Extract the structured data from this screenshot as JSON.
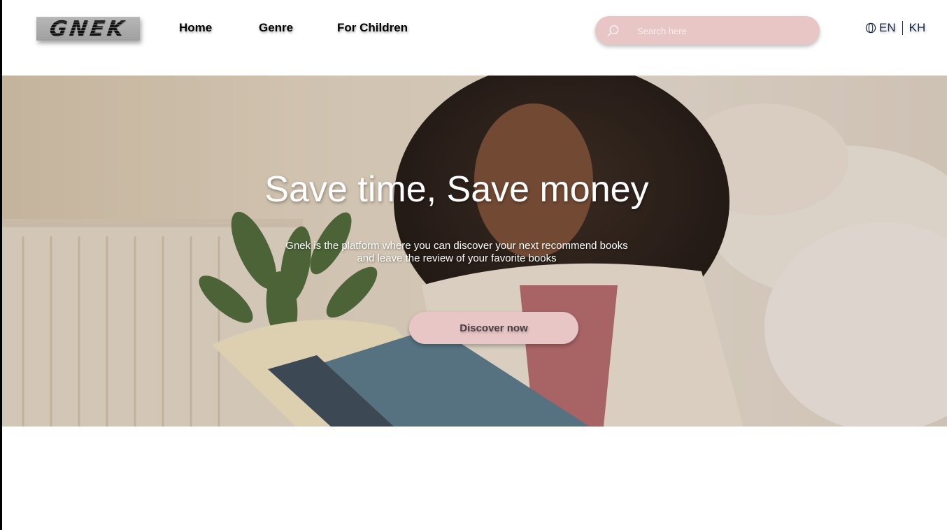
{
  "header": {
    "logo_text": "GNEK",
    "nav": {
      "home": "Home",
      "genre": "Genre",
      "for_children": "For Children"
    },
    "search": {
      "placeholder": "Search here",
      "icon": "search-icon"
    },
    "language": {
      "icon": "globe-icon",
      "options": [
        "EN",
        "KH"
      ]
    }
  },
  "hero": {
    "title": "Save time, Save money",
    "subtitle_line1": "Gnek is the platform where you can discover your next recommend books",
    "subtitle_line2": "and leave the review of your favorite books",
    "cta_label": "Discover now",
    "background_image": "woman reading a book on a sofa"
  },
  "colors": {
    "accent_pink": "#e8c6c6",
    "nav_text": "#000000",
    "language_text": "#1d2a44",
    "cta_text": "#4a3e44"
  }
}
